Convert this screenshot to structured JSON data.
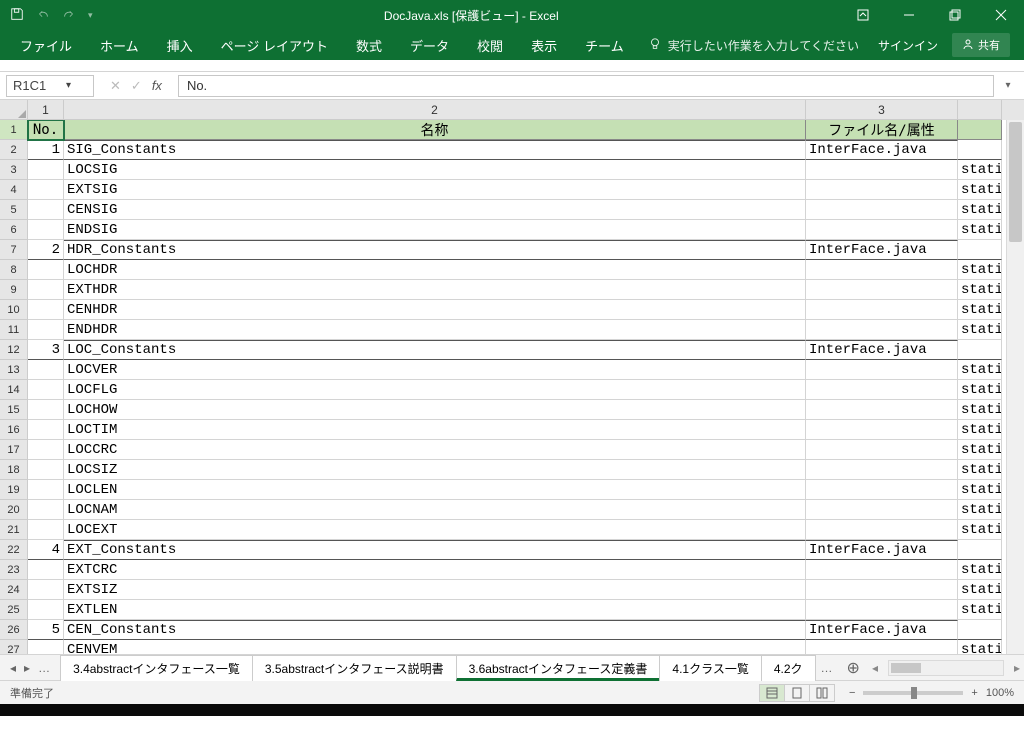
{
  "titlebar": {
    "title": "DocJava.xls  [保護ビュー] - Excel"
  },
  "window_buttons": {
    "restore": "❐"
  },
  "ribbon": {
    "tabs": [
      "ファイル",
      "ホーム",
      "挿入",
      "ページ レイアウト",
      "数式",
      "データ",
      "校閲",
      "表示",
      "チーム"
    ],
    "tellme": "実行したい作業を入力してください",
    "signin": "サインイン",
    "share": "共有"
  },
  "formula_bar": {
    "name": "R1C1",
    "value": "No."
  },
  "columns": {
    "c1": "1",
    "c2": "2",
    "c3": "3",
    "c4": ""
  },
  "headers": {
    "no": "No.",
    "name": "名称",
    "file": "ファイル名/属性",
    "attr": ""
  },
  "rows": [
    {
      "r": 2,
      "no": "1",
      "name": "SIG_Constants",
      "file": "InterFace.java",
      "attr": "",
      "sec": true
    },
    {
      "r": 3,
      "name": "LOCSIG",
      "attr": "stati"
    },
    {
      "r": 4,
      "name": "EXTSIG",
      "attr": "stati"
    },
    {
      "r": 5,
      "name": "CENSIG",
      "attr": "stati"
    },
    {
      "r": 6,
      "name": "ENDSIG",
      "attr": "stati"
    },
    {
      "r": 7,
      "no": "2",
      "name": "HDR_Constants",
      "file": "InterFace.java",
      "attr": "",
      "sec": true
    },
    {
      "r": 8,
      "name": "LOCHDR",
      "attr": "stati"
    },
    {
      "r": 9,
      "name": "EXTHDR",
      "attr": "stati"
    },
    {
      "r": 10,
      "name": "CENHDR",
      "attr": "stati"
    },
    {
      "r": 11,
      "name": "ENDHDR",
      "attr": "stati"
    },
    {
      "r": 12,
      "no": "3",
      "name": "LOC_Constants",
      "file": "InterFace.java",
      "attr": "",
      "sec": true
    },
    {
      "r": 13,
      "name": "LOCVER",
      "attr": "stati"
    },
    {
      "r": 14,
      "name": "LOCFLG",
      "attr": "stati"
    },
    {
      "r": 15,
      "name": "LOCHOW",
      "attr": "stati"
    },
    {
      "r": 16,
      "name": "LOCTIM",
      "attr": "stati"
    },
    {
      "r": 17,
      "name": "LOCCRC",
      "attr": "stati"
    },
    {
      "r": 18,
      "name": "LOCSIZ",
      "attr": "stati"
    },
    {
      "r": 19,
      "name": "LOCLEN",
      "attr": "stati"
    },
    {
      "r": 20,
      "name": "LOCNAM",
      "attr": "stati"
    },
    {
      "r": 21,
      "name": "LOCEXT",
      "attr": "stati"
    },
    {
      "r": 22,
      "no": "4",
      "name": "EXT_Constants",
      "file": "InterFace.java",
      "attr": "",
      "sec": true
    },
    {
      "r": 23,
      "name": "EXTCRC",
      "attr": "stati"
    },
    {
      "r": 24,
      "name": "EXTSIZ",
      "attr": "stati"
    },
    {
      "r": 25,
      "name": "EXTLEN",
      "attr": "stati"
    },
    {
      "r": 26,
      "no": "5",
      "name": "CEN_Constants",
      "file": "InterFace.java",
      "attr": "",
      "sec": true
    },
    {
      "r": 27,
      "name": "CENVEM",
      "attr": "stati"
    }
  ],
  "sheets": {
    "ellipsis": "…",
    "tabs": [
      {
        "label": "3.4abstractインタフェース一覧",
        "active": false
      },
      {
        "label": "3.5abstractインタフェース説明書",
        "active": false
      },
      {
        "label": "3.6abstractインタフェース定義書",
        "active": true
      },
      {
        "label": "4.1クラス一覧",
        "active": false
      },
      {
        "label": "4.2ク",
        "active": false,
        "trunc": true
      }
    ],
    "more": "…"
  },
  "status": {
    "ready": "準備完了",
    "zoom": "100%"
  }
}
